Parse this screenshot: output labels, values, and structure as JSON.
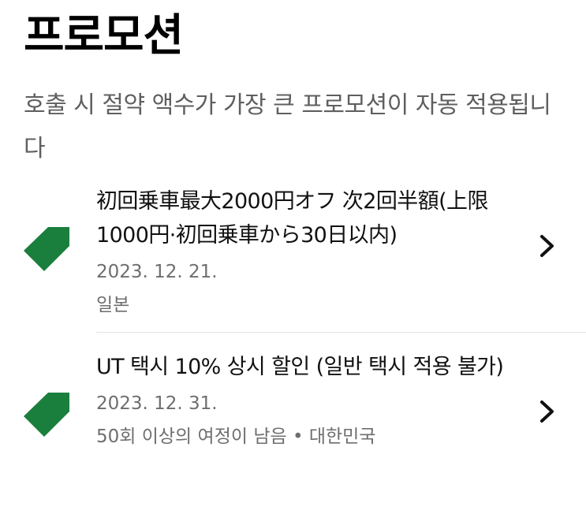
{
  "header": {
    "title": "프로모션"
  },
  "description": "호출 시 절약 액수가 가장 큰 프로모션이 자동 적용됩니다",
  "promotions": [
    {
      "title": "初回乗車最大2000円オフ 次2回半額(上限1000円·初回乗車から30日以内)",
      "date": "2023. 12. 21.",
      "meta": "일본",
      "icon": "tag-icon",
      "chevron": "chevron-right-icon"
    },
    {
      "title": "UT 택시 10% 상시 할인 (일반 택시 적용 불가)",
      "date": "2023. 12. 31.",
      "meta": "50회 이상의 여정이 남음 • 대한민국",
      "icon": "tag-icon",
      "chevron": "chevron-right-icon"
    }
  ],
  "colors": {
    "tag_green": "#1a7f3c",
    "text_primary": "#111111",
    "text_secondary": "#6e6e6e"
  }
}
